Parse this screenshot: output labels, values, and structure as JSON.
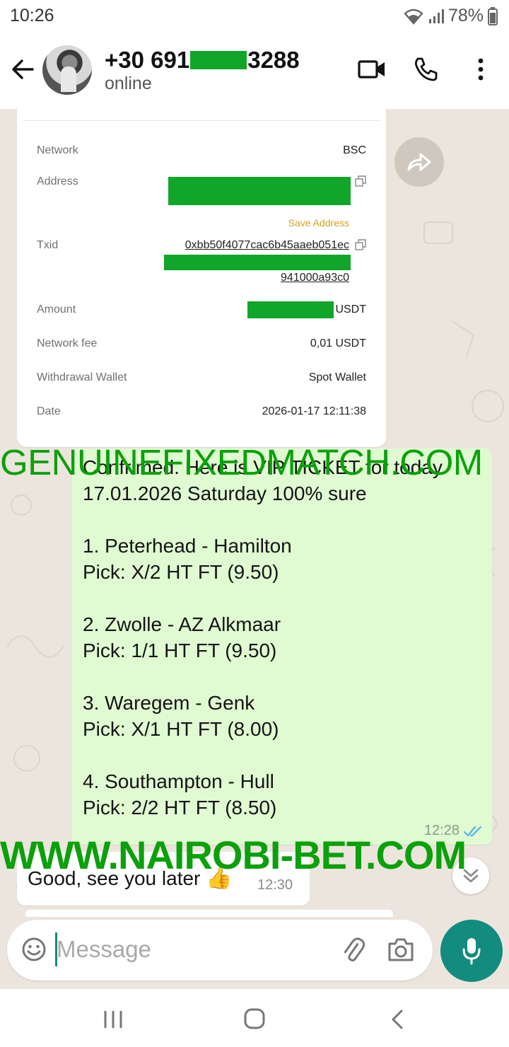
{
  "status_bar": {
    "time": "10:26",
    "battery": "78%"
  },
  "header": {
    "phone_prefix": "+30 691",
    "phone_suffix": "3288",
    "status": "online"
  },
  "receipt": {
    "rows": [
      {
        "label": "Network",
        "value": "BSC"
      },
      {
        "label": "Address",
        "value": ""
      },
      {
        "label": "Txid",
        "value_line1": "0xbb50f4077cac6b45aaeb051ec",
        "value_line3": "941000a93c0"
      },
      {
        "label": "Amount",
        "value": "USDT"
      },
      {
        "label": "Network fee",
        "value": "0,01 USDT"
      },
      {
        "label": "Withdrawal Wallet",
        "value": "Spot Wallet"
      },
      {
        "label": "Date",
        "value": "2026-01-17 12:11:38"
      }
    ],
    "save_address": "Save Address"
  },
  "messages": {
    "outgoing": {
      "text": "Confrimed. Here is VIP TICKET for today 17.01.2026 Saturday 100% sure\n\n1. Peterhead - Hamilton\nPick: X/2 HT FT (9.50)\n\n2. Zwolle - AZ Alkmaar\nPick: 1/1 HT FT (9.50)\n\n3. Waregem - Genk\nPick: X/1 HT FT (8.00)\n\n4. Southampton - Hull\nPick: 2/2 HT FT (8.50)",
      "time": "12:28"
    },
    "incoming": {
      "text": "Good, see you later",
      "emoji": "👍",
      "time": "12:30"
    }
  },
  "watermarks": {
    "top": "GENUINEFIXEDMATCH.COM",
    "bottom": "WWW.NAIROBI-BET.COM"
  },
  "composer": {
    "placeholder": "Message"
  },
  "colors": {
    "accent": "#128c7e",
    "outgoing_bubble": "#e0fbd2",
    "redaction": "#11a52a",
    "watermark": "#0aa10a"
  }
}
